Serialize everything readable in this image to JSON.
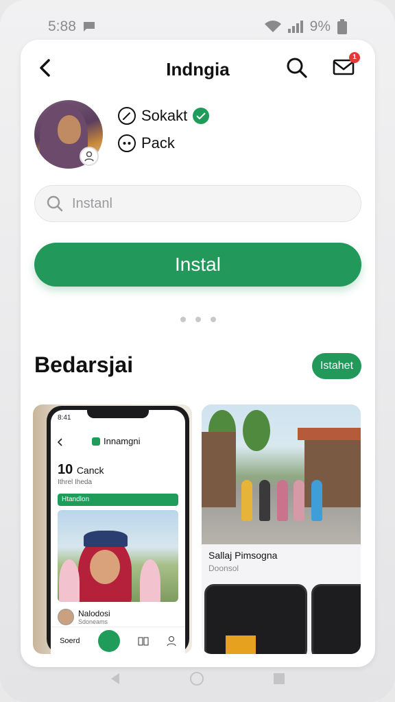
{
  "status_bar": {
    "time": "5:88",
    "battery": "9%"
  },
  "header": {
    "title": "Indngia",
    "mail_badge": "1"
  },
  "profile": {
    "line1": "Sokakt",
    "line2": "Pack"
  },
  "search": {
    "placeholder": "Instanl"
  },
  "install_button": {
    "label": "Instal"
  },
  "section": {
    "title": "Bedarsjai",
    "action_label": "Istahet"
  },
  "left_screenshot": {
    "status_time": "8:41",
    "app_title": "Innamgni",
    "count_number": "10",
    "count_label": "Canck",
    "count_sub": "Ithrel Iheda",
    "banner_label": "Htandlon",
    "user_name": "Nalodosi",
    "user_sub": "Sdoneams",
    "nav_label": "Soerd"
  },
  "right_screenshot": {
    "caption_title": "Sallaj Pimsogna",
    "caption_sub": "Doonsol"
  },
  "colors": {
    "accent": "#22985a",
    "badge": "#e53935"
  }
}
